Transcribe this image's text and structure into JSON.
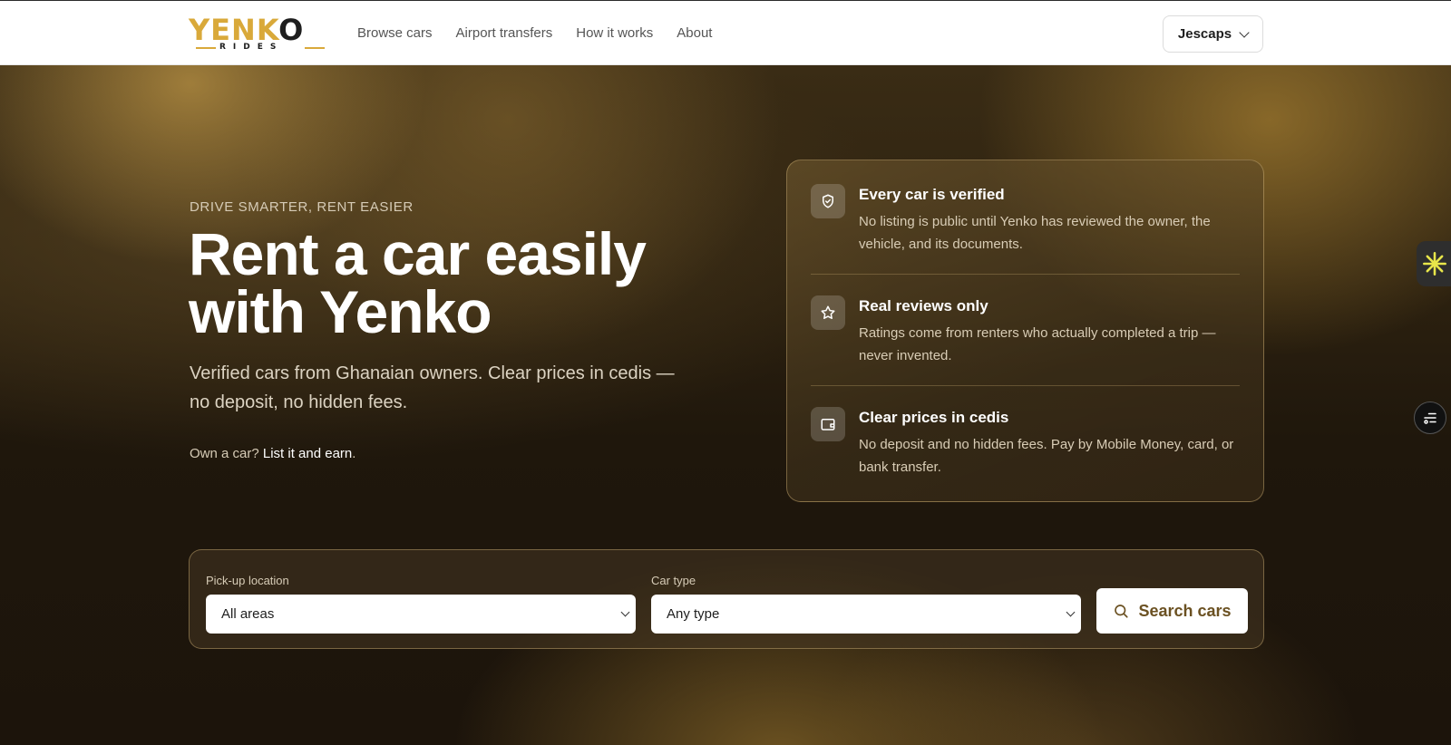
{
  "header": {
    "logo": {
      "word_gold": "YENK",
      "word_dark": "O",
      "sub": "RIDES"
    },
    "nav": [
      "Browse cars",
      "Airport transfers",
      "How it works",
      "About"
    ],
    "user_menu": {
      "label": "Jescaps",
      "icon": "chevron-down-icon"
    }
  },
  "hero": {
    "eyebrow": "DRIVE SMARTER, RENT EASIER",
    "headline_line1": "Rent a car easily",
    "headline_line2": "with Yenko",
    "subtext": "Verified cars from Ghanaian owners. Clear prices in cedis — no deposit, no hidden fees.",
    "owner_prompt": "Own a car?",
    "owner_link": "List it and earn",
    "owner_suffix": "."
  },
  "features": [
    {
      "icon": "shield-check-icon",
      "title": "Every car is verified",
      "text": "No listing is public until Yenko has reviewed the owner, the vehicle, and its documents."
    },
    {
      "icon": "star-icon",
      "title": "Real reviews only",
      "text": "Ratings come from renters who actually completed a trip — never invented."
    },
    {
      "icon": "wallet-icon",
      "title": "Clear prices in cedis",
      "text": "No deposit and no hidden fees. Pay by Mobile Money, card, or bank transfer."
    }
  ],
  "search": {
    "location_label": "Pick-up location",
    "location_value": "All areas",
    "type_label": "Car type",
    "type_value": "Any type",
    "button_label": "Search cars"
  },
  "colors": {
    "brand_gold": "#d9a93a",
    "button_text": "#6b5122",
    "hero_dark": "#1c140b"
  }
}
